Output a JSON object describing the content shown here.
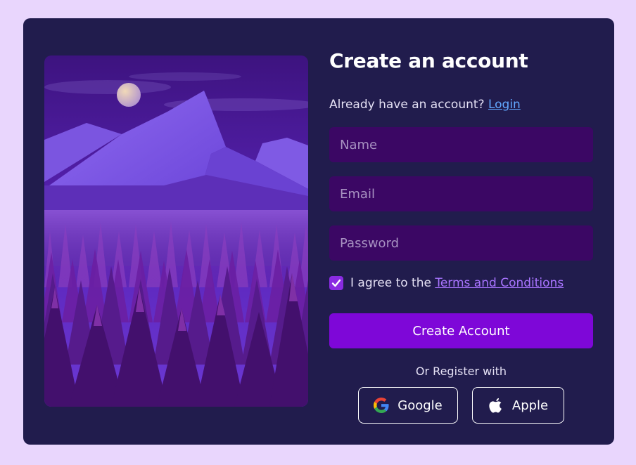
{
  "form": {
    "title": "Create an account",
    "login_prompt": "Already have an account?",
    "login_link": "Login",
    "name_placeholder": "Name",
    "email_placeholder": "Email",
    "password_placeholder": "Password",
    "agree_prefix": "I agree to the",
    "terms_link": "Terms and Conditions",
    "terms_checked": true,
    "submit_label": "Create Account",
    "or_text": "Or Register with"
  },
  "social": {
    "google_label": "Google",
    "google_icon": "google-icon",
    "apple_label": "Apple",
    "apple_icon": "apple-icon"
  },
  "colors": {
    "page_bg": "#e9d6fd",
    "card_bg": "#211c4d",
    "input_bg": "#3b0764",
    "accent": "#7e07d8",
    "login_link": "#62a8ff",
    "terms_link": "#a874ff"
  },
  "illustration": "mountain-forest-night-illustration"
}
